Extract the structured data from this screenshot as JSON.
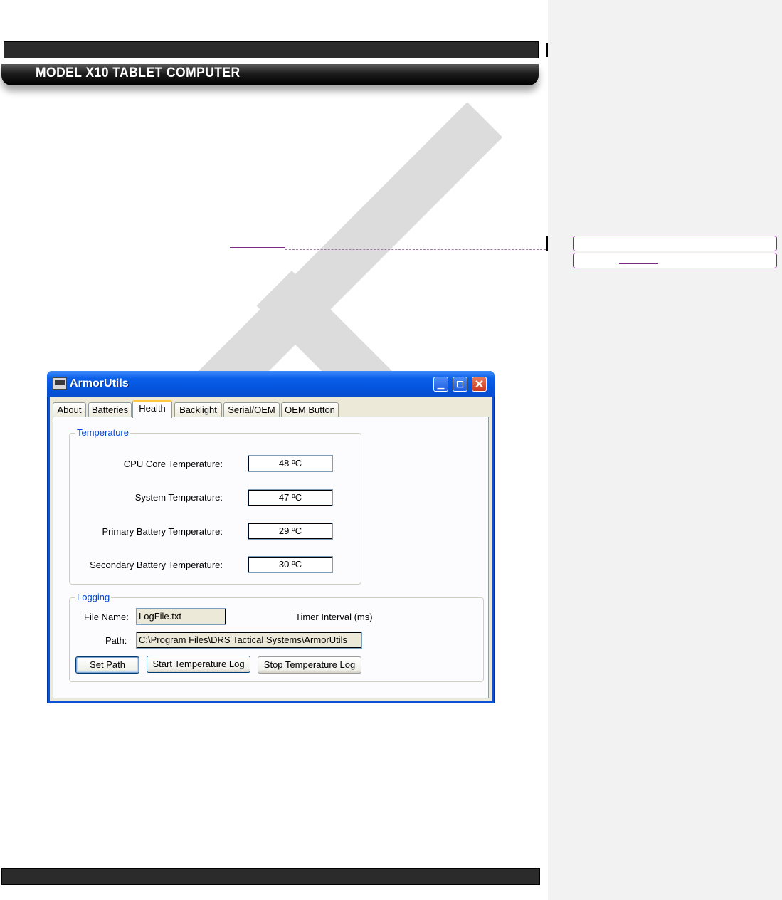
{
  "document": {
    "header_title": "MODEL X10 TABLET COMPUTER"
  },
  "window": {
    "title": "ArmorUtils",
    "controls": [
      "minimize-icon",
      "maximize-icon",
      "close-icon"
    ]
  },
  "tabs": [
    {
      "label": "About",
      "active": false
    },
    {
      "label": "Batteries",
      "active": false
    },
    {
      "label": "Health",
      "active": true
    },
    {
      "label": "Backlight",
      "active": false
    },
    {
      "label": "Serial/OEM",
      "active": false
    },
    {
      "label": "OEM Button",
      "active": false
    }
  ],
  "temperature": {
    "legend": "Temperature",
    "rows": [
      {
        "label": "CPU Core Temperature:",
        "value": "48 ºC"
      },
      {
        "label": "System Temperature:",
        "value": "47 ºC"
      },
      {
        "label": "Primary Battery Temperature:",
        "value": "29 ºC"
      },
      {
        "label": "Secondary Battery Temperature:",
        "value": "30 ºC"
      }
    ]
  },
  "logging": {
    "legend": "Logging",
    "file_name_label": "File Name:",
    "file_name_value": "LogFile.txt",
    "timer_interval_label": "Timer Interval (ms)",
    "path_label": "Path:",
    "path_value": "C:\\Program Files\\DRS Tactical Systems\\ArmorUtils",
    "buttons": {
      "set_path": "Set Path",
      "start_log": "Start Temperature Log",
      "stop_log": "Stop Temperature Log"
    }
  },
  "colors": {
    "titlebar_blue": "#0a5fe8",
    "tab_highlight": "#ffc83c",
    "group_legend": "#0046d5",
    "comment_marker": "#7a2a82"
  }
}
